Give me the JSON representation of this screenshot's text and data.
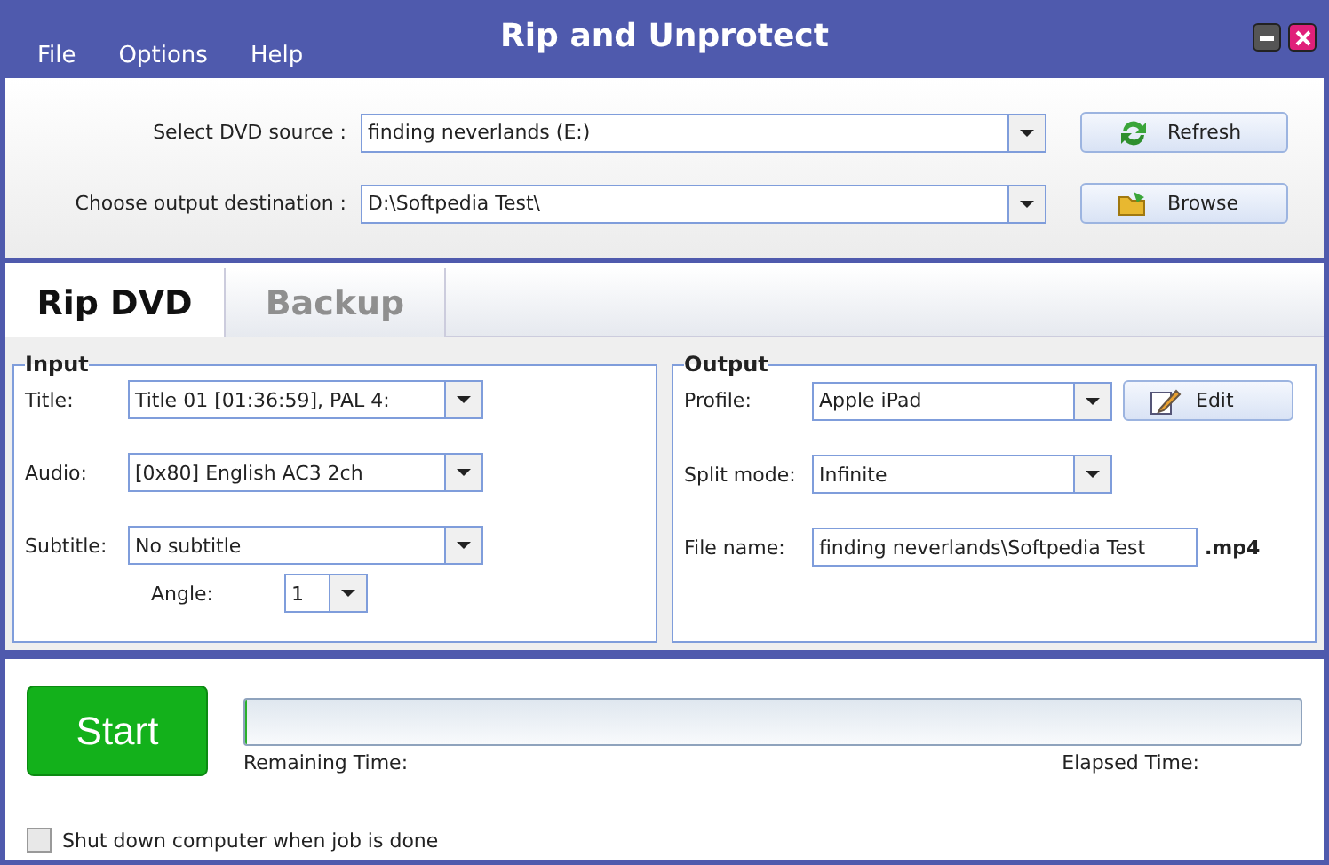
{
  "window": {
    "title": "Rip and Unprotect"
  },
  "menu": [
    "File",
    "Options",
    "Help"
  ],
  "source": {
    "label": "Select DVD source :",
    "value": "finding neverlands (E:)",
    "button": "Refresh"
  },
  "destination": {
    "label": "Choose output destination :",
    "value": "D:\\Softpedia Test\\",
    "button": "Browse"
  },
  "tabs": [
    {
      "label": "Rip DVD",
      "selected": true
    },
    {
      "label": "Backup",
      "selected": false
    }
  ],
  "input": {
    "title": "Input",
    "title_label": "Title:",
    "title_value": "Title 01 [01:36:59], PAL 4:",
    "audio_label": "Audio:",
    "audio_value": "[0x80] English AC3 2ch",
    "subtitle_label": "Subtitle:",
    "subtitle_value": "No subtitle",
    "angle_label": "Angle:",
    "angle_value": "1"
  },
  "output": {
    "title": "Output",
    "profile_label": "Profile:",
    "profile_value": "Apple iPad",
    "edit_button": "Edit",
    "split_label": "Split mode:",
    "split_value": "Infinite",
    "file_label": "File name:",
    "file_value": "finding neverlands\\Softpedia Test",
    "extension": ".mp4"
  },
  "start_button": "Start",
  "progress": {
    "level": 0.002,
    "remaining_label": "Remaining Time:",
    "elapsed_label": "Elapsed Time:"
  },
  "shutdown": {
    "label": "Shut down computer when job is done",
    "checked": false
  }
}
